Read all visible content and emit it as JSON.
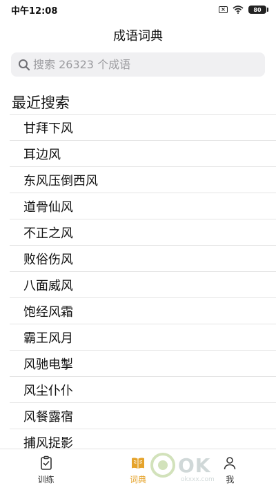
{
  "status_bar": {
    "time": "中午12:08",
    "battery": "80"
  },
  "header": {
    "title": "成语词典"
  },
  "search": {
    "placeholder": "搜索 26323 个成语"
  },
  "recent": {
    "title": "最近搜索",
    "items": [
      "甘拜下风",
      "耳边风",
      "东风压倒西风",
      "道骨仙风",
      "不正之风",
      "败俗伤风",
      "八面威风",
      "饱经风霜",
      "霸王风月",
      "风驰电掣",
      "风尘仆仆",
      "风餐露宿",
      "捕风捉影"
    ]
  },
  "tabs": [
    {
      "label": "训练",
      "icon": "clipboard-check-icon",
      "active": false
    },
    {
      "label": "词典",
      "icon": "book-icon",
      "active": true
    },
    {
      "label": "我",
      "icon": "user-icon",
      "active": false
    }
  ],
  "colors": {
    "accent": "#e5a32b",
    "search_bg": "#f0f0f2",
    "divider": "#e4e4e4"
  },
  "watermark": {
    "text": "OK",
    "sub": "okxxx.com"
  }
}
